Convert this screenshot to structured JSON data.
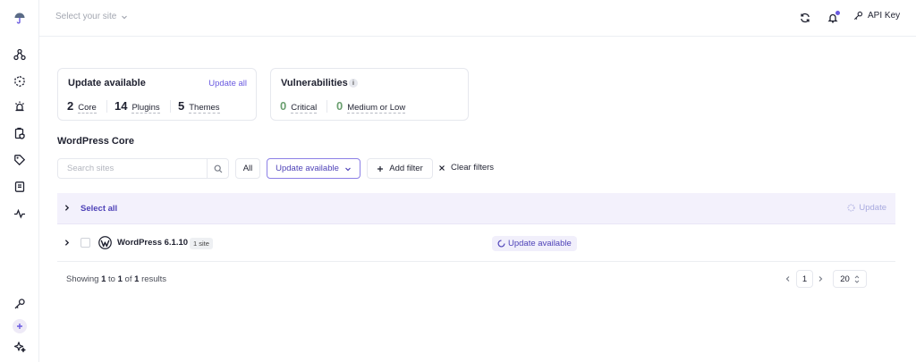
{
  "sidebar": {
    "items": [
      {
        "icon": "umbrella-logo-icon"
      },
      {
        "icon": "sites-network-icon"
      },
      {
        "icon": "cube-icon"
      },
      {
        "icon": "bug-icon"
      },
      {
        "icon": "clipboard-shield-icon"
      },
      {
        "icon": "tag-icon"
      },
      {
        "icon": "book-icon"
      },
      {
        "icon": "activity-icon"
      },
      {
        "icon": "key-icon"
      },
      {
        "icon": "plus-icon"
      },
      {
        "icon": "sparkle-icon"
      }
    ]
  },
  "topbar": {
    "site_select": "Select your site",
    "api_key": "API Key"
  },
  "update_card": {
    "title": "Update available",
    "action": "Update all",
    "stats": [
      {
        "value": "2",
        "label": "Core"
      },
      {
        "value": "14",
        "label": "Plugins"
      },
      {
        "value": "5",
        "label": "Themes"
      }
    ]
  },
  "vuln_card": {
    "title": "Vulnerabilities",
    "info": "i",
    "stats": [
      {
        "value": "0",
        "label": "Critical"
      },
      {
        "value": "0",
        "label": "Medium or Low"
      }
    ]
  },
  "section_title": "WordPress Core",
  "filters": {
    "search_placeholder": "Search sites",
    "all": "All",
    "active_filter": "Update available",
    "add_filter": "Add filter",
    "clear_filters": "Clear filters"
  },
  "table": {
    "select_all": "Select all",
    "bulk_update": "Update",
    "rows": [
      {
        "name": "WordPress 6.1.10",
        "badge": "1 site",
        "status": "Update available"
      }
    ]
  },
  "pagination": {
    "showing_prefix": "Showing",
    "from": "1",
    "to_word": "to",
    "to": "1",
    "of_word": "of",
    "total": "1",
    "suffix": "results",
    "page": "1",
    "per_page": "20"
  },
  "colors": {
    "accent": "#6a5ae0",
    "accent_dark": "#4f43b8",
    "zero_green": "#6a9f6f",
    "row_highlight": "#f3f1fc"
  }
}
